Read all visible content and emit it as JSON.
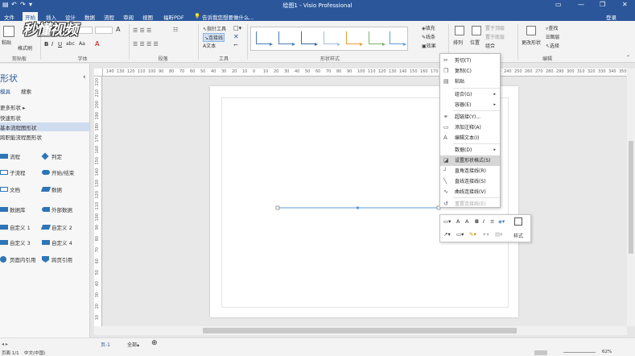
{
  "titlebar": {
    "title": "绘图1 - Visio Professional",
    "login": "登录",
    "minimize": "—",
    "restore": "❐",
    "close": "✕"
  },
  "tabs": [
    {
      "label": "文件"
    },
    {
      "label": "开始"
    },
    {
      "label": "插入"
    },
    {
      "label": "设计"
    },
    {
      "label": "数据"
    },
    {
      "label": "流程"
    },
    {
      "label": "审阅"
    },
    {
      "label": "视图"
    },
    {
      "label": "福昕PDF"
    }
  ],
  "tell_me": "告诉我您想要做什么...",
  "share": "共享",
  "watermark": "秒懂视频",
  "ribbon": {
    "clipboard": {
      "paste": "粘贴",
      "cut_hint": "✂",
      "format_painter": "格式刷",
      "label": "剪贴板"
    },
    "font": {
      "bold": "B",
      "italic": "I",
      "underline": "U",
      "abc": "abc",
      "aa": "Aa",
      "grow": "A",
      "label": "字体"
    },
    "paragraph": {
      "label": "段落"
    },
    "tools": {
      "pointer": "指针工具",
      "connector": "连接线",
      "text": "文本",
      "label": "工具"
    },
    "shape_styles": {
      "label": "形状样式"
    },
    "fill": "填充",
    "line": "线条",
    "effect": "效果",
    "arrange": {
      "align": "排列",
      "position": "位置",
      "bring_front": "置于顶层",
      "send_back": "置于底层",
      "group": "组合",
      "label": "排列"
    },
    "editing": {
      "change_shape": "更改形状",
      "find": "查找",
      "layers": "图层",
      "select": "选择",
      "label": "编辑"
    }
  },
  "leftpane": {
    "title": "形状",
    "tab_stencils": "模具",
    "tab_search": "搜索",
    "more_shapes": "更多形状",
    "quick_shapes": "快速形状",
    "basic_flowchart": "基本流程图形状",
    "cross_functional": "跨职能流程图形状",
    "shapes": [
      {
        "left": "流程",
        "right": "判定"
      },
      {
        "left": "子流程",
        "right": "开始/结束"
      },
      {
        "left": "文档",
        "right": "数据"
      },
      {
        "left": "数据库",
        "right": "外部数据"
      },
      {
        "left": "自定义 1",
        "right": "自定义 2"
      },
      {
        "left": "自定义 3",
        "right": "自定义 4"
      },
      {
        "left": "页面内引用",
        "right": "跨页引用"
      }
    ],
    "collapse": "‹"
  },
  "ruler_top": [
    "140",
    "130",
    "120",
    "110",
    "100",
    "90",
    "80",
    "70",
    "60",
    "50",
    "40",
    "30",
    "20",
    "10",
    "0",
    "10",
    "20",
    "30",
    "40",
    "50",
    "60",
    "70",
    "80",
    "90",
    "100",
    "110",
    "120",
    "130",
    "140",
    "150",
    "160",
    "170",
    "180",
    "190",
    "200",
    "210",
    "220",
    "230",
    "240",
    "250",
    "260",
    "270",
    "280",
    "290",
    "300",
    "310",
    "320",
    "330",
    "340",
    "350",
    "360",
    "370"
  ],
  "ruler_left": [
    "220",
    "210",
    "200",
    "190",
    "180",
    "170",
    "160",
    "150",
    "140",
    "130",
    "120",
    "110",
    "100",
    "90",
    "80",
    "70",
    "60",
    "50",
    "40",
    "30",
    "20",
    "10"
  ],
  "context_menu": {
    "items": [
      {
        "label": "剪切(T)",
        "icon": "✂",
        "arrow": ""
      },
      {
        "label": "复制(C)",
        "icon": "❐",
        "arrow": ""
      },
      {
        "label": "粘贴",
        "icon": "▤",
        "arrow": ""
      },
      {
        "label": "组合(G)",
        "icon": "",
        "arrow": "▸"
      },
      {
        "label": "容器(E)",
        "icon": "",
        "arrow": "▸"
      },
      {
        "label": "超链接(Y)...",
        "icon": "⚭",
        "arrow": ""
      },
      {
        "label": "添加注释(A)",
        "icon": "▭",
        "arrow": ""
      },
      {
        "label": "编辑文本(I)",
        "icon": "A",
        "arrow": ""
      },
      {
        "label": "数据(D)",
        "icon": "",
        "arrow": "▸"
      },
      {
        "label": "设置形状格式(S)",
        "icon": "◪",
        "arrow": ""
      },
      {
        "label": "直角连接线(R)",
        "icon": "┘",
        "arrow": ""
      },
      {
        "label": "直线连接线(S)",
        "icon": "╲",
        "arrow": ""
      },
      {
        "label": "曲线连接线(V)",
        "icon": "∿",
        "arrow": ""
      },
      {
        "label": "重置连接线(E)",
        "icon": "↺",
        "arrow": ""
      }
    ]
  },
  "mini_toolbar": {
    "style": "样式"
  },
  "statusbar": {
    "page_tab": "页-1",
    "all": "全部",
    "add": "⊕",
    "left_info": "页面 1/1",
    "lang": "中文(中国)",
    "zoom": "62%"
  },
  "colors": {
    "brand": "#2b579a",
    "accent": "#2e75b6",
    "highlight": "#d6d6d6"
  }
}
